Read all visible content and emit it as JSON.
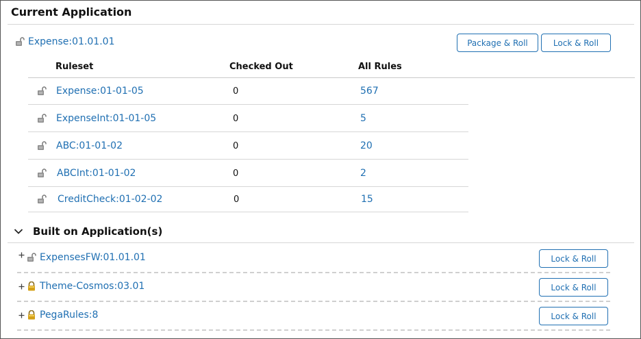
{
  "current_application": {
    "title": "Current Application",
    "app_name": "Expense:01.01.01",
    "package_roll_label": "Package & Roll",
    "lock_roll_label": "Lock & Roll"
  },
  "rulesets_table": {
    "columns": [
      "Ruleset",
      "Checked Out",
      "All Rules"
    ],
    "rows": [
      {
        "name": "Expense:01-01-05",
        "checked_out": "0",
        "all_rules": "567"
      },
      {
        "name": "ExpenseInt:01-01-05",
        "checked_out": "0",
        "all_rules": "5"
      },
      {
        "name": "ABC:01-01-02",
        "checked_out": "0",
        "all_rules": "20"
      },
      {
        "name": "ABCInt:01-01-02",
        "checked_out": "0",
        "all_rules": "2"
      },
      {
        "name": "CreditCheck:01-02-02",
        "checked_out": "0",
        "all_rules": "15"
      }
    ]
  },
  "built_on": {
    "title": "Built on Application(s)",
    "items": [
      {
        "name": "ExpensesFW:01.01.01",
        "lock": "unlocked",
        "button_label": "Lock & Roll"
      },
      {
        "name": "Theme-Cosmos:03.01",
        "lock": "locked",
        "button_label": "Lock & Roll"
      },
      {
        "name": "PegaRules:8",
        "lock": "locked",
        "button_label": "Lock & Roll"
      }
    ]
  },
  "icons": {
    "unlocked": "unlocked-padlock-icon",
    "locked": "locked-padlock-icon",
    "collapse": "chevron-down-icon",
    "expand": "plus-icon"
  },
  "colors": {
    "link": "#1f6fb2",
    "lock_gold": "#d4a017",
    "lock_gray": "#7a7a7a"
  }
}
